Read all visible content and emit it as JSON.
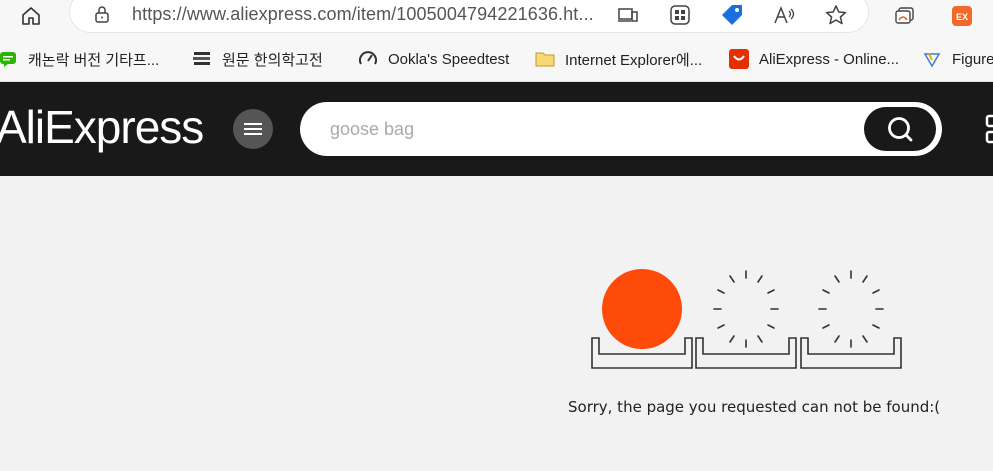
{
  "browser": {
    "url": "https://www.aliexpress.com/item/1005004794221636.ht...",
    "extension_badge": "EX"
  },
  "bookmarks": [
    {
      "label": "캐논락 버전 기타프...",
      "icon": "chat-bubble-icon"
    },
    {
      "label": "원문 한의학고전",
      "icon": "books-icon"
    },
    {
      "label": "Ookla's Speedtest",
      "icon": "speedometer-icon"
    },
    {
      "label": "Internet Explorer에...",
      "icon": "folder-icon"
    },
    {
      "label": "AliExpress - Online...",
      "icon": "aliexpress-icon"
    },
    {
      "label": "Figure",
      "icon": "figure-icon"
    }
  ],
  "header": {
    "logo": "AliExpress",
    "search_placeholder": "goose bag"
  },
  "error": {
    "message": "Sorry, the page you requested can not be found:("
  },
  "colors": {
    "header_bg": "#191919",
    "sun": "#ff4b0a",
    "page_bg": "#f2f2f2"
  }
}
